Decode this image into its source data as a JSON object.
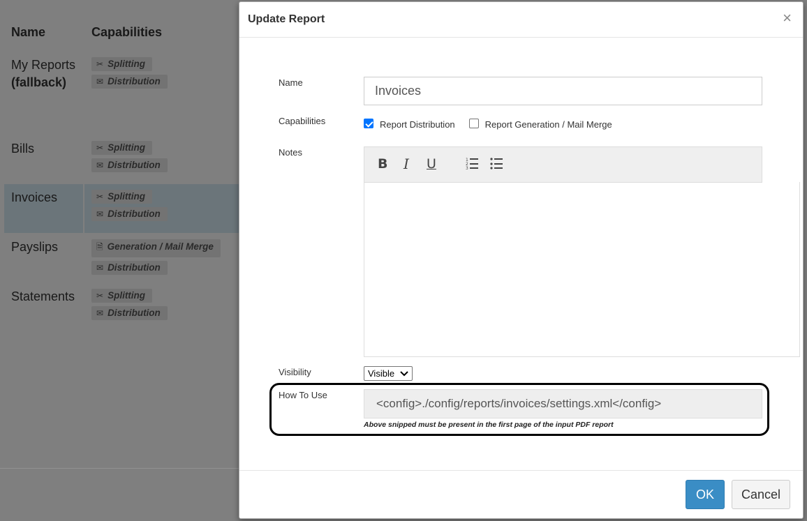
{
  "background": {
    "headers": {
      "name": "Name",
      "capabilities": "Capabilities"
    },
    "rows": [
      {
        "name": "My Reports",
        "name_bold": "(fallback)",
        "caps": [
          {
            "icon": "scissors-icon",
            "label": "Splitting"
          },
          {
            "icon": "envelope-icon",
            "label": "Distribution"
          }
        ]
      },
      {
        "name": "Bills",
        "caps": [
          {
            "icon": "scissors-icon",
            "label": "Splitting"
          },
          {
            "icon": "envelope-icon",
            "label": "Distribution"
          }
        ]
      },
      {
        "name": "Invoices",
        "selected": true,
        "caps": [
          {
            "icon": "scissors-icon",
            "label": "Splitting"
          },
          {
            "icon": "envelope-icon",
            "label": "Distribution"
          }
        ]
      },
      {
        "name": "Payslips",
        "caps": [
          {
            "icon": "document-icon",
            "label": "Generation / Mail Merge"
          },
          {
            "icon": "envelope-icon",
            "label": "Distribution"
          }
        ]
      },
      {
        "name": "Statements",
        "caps": [
          {
            "icon": "scissors-icon",
            "label": "Splitting"
          },
          {
            "icon": "envelope-icon",
            "label": "Distribution"
          }
        ]
      }
    ]
  },
  "modal": {
    "title": "Update Report",
    "close_symbol": "×",
    "labels": {
      "name": "Name",
      "capabilities": "Capabilities",
      "notes": "Notes",
      "visibility": "Visibility",
      "how_to_use": "How To Use"
    },
    "name_value": "Invoices",
    "capabilities": [
      {
        "label": "Report Distribution",
        "checked": true
      },
      {
        "label": "Report Generation / Mail Merge",
        "checked": false
      }
    ],
    "toolbar": {
      "bold": "B",
      "italic": "I",
      "underline": "U",
      "ordered_list_icon": "ordered-list-icon",
      "bullet_list_icon": "bullet-list-icon"
    },
    "visibility_value": "Visible",
    "how_to_use_snippet": "<config>./config/reports/invoices/settings.xml</config>",
    "how_to_use_help": "Above snipped must be present in the first page of the input PDF report",
    "buttons": {
      "ok": "OK",
      "cancel": "Cancel"
    }
  }
}
